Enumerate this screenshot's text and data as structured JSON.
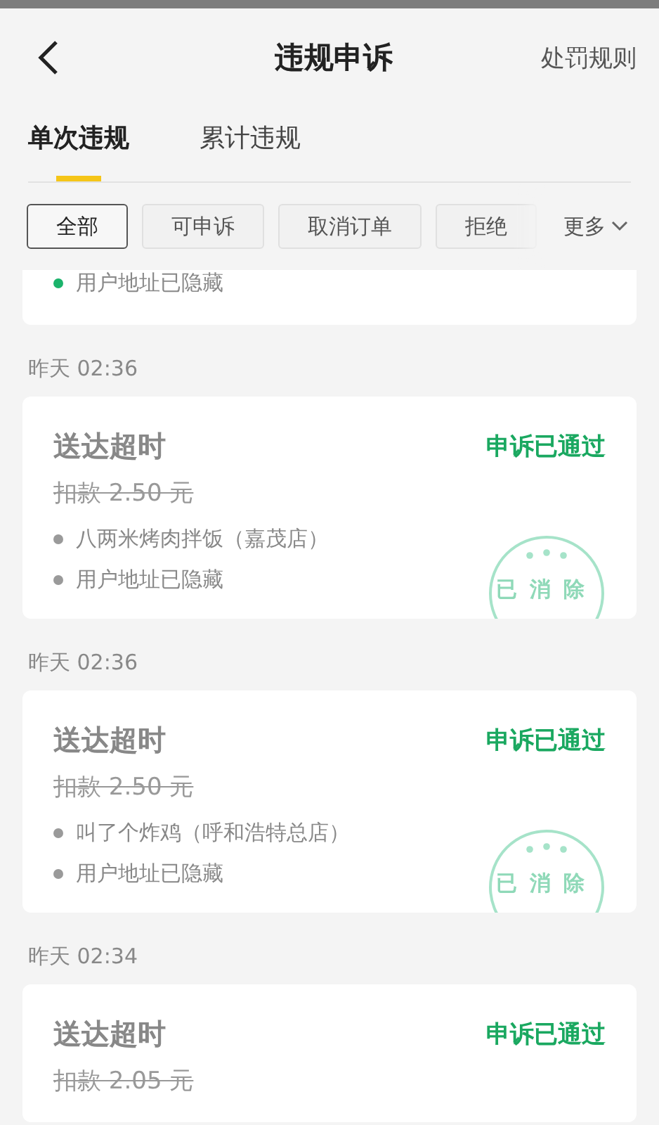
{
  "header": {
    "title": "违规申诉",
    "action": "处罚规则"
  },
  "tabs": [
    {
      "label": "单次违规",
      "selected": true
    },
    {
      "label": "累计违规",
      "selected": false
    }
  ],
  "filters": [
    {
      "label": "全部",
      "selected": true
    },
    {
      "label": "可申诉",
      "selected": false
    },
    {
      "label": "取消订单",
      "selected": false
    },
    {
      "label": "拒绝",
      "selected": false
    }
  ],
  "more": "更多",
  "partial_card": {
    "lines": [
      {
        "text": "用户地址已隐藏",
        "color": "#1bb36b"
      }
    ]
  },
  "records": [
    {
      "time": "昨天 02:36",
      "title": "送达超时",
      "status": "申诉已通过",
      "fee": "扣款 2.50 元",
      "lines": [
        {
          "text": "八两米烤肉拌饭（嘉茂店）",
          "color": "#9a9a9a"
        },
        {
          "text": "用户地址已隐藏",
          "color": "#9a9a9a"
        }
      ],
      "stamp": "已消除"
    },
    {
      "time": "昨天 02:36",
      "title": "送达超时",
      "status": "申诉已通过",
      "fee": "扣款 2.50 元",
      "lines": [
        {
          "text": "叫了个炸鸡（呼和浩特总店）",
          "color": "#9a9a9a"
        },
        {
          "text": "用户地址已隐藏",
          "color": "#9a9a9a"
        }
      ],
      "stamp": "已消除"
    },
    {
      "time": "昨天 02:34",
      "title": "送达超时",
      "status": "申诉已通过",
      "fee": "扣款 2.05 元"
    }
  ]
}
